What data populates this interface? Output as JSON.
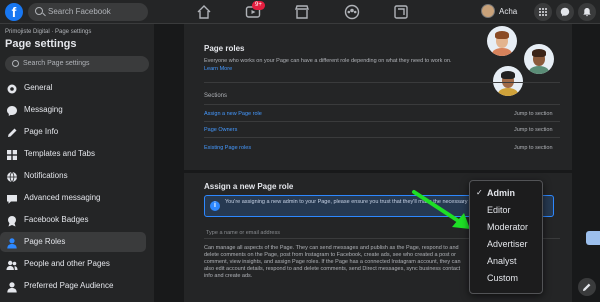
{
  "topnav": {
    "search_placeholder": "Search Facebook",
    "badge": "9+",
    "profile_name": "Acha"
  },
  "sidebar": {
    "breadcrumb": "Primojiste Digital · Page settings",
    "title": "Page settings",
    "search_placeholder": "Search Page settings",
    "items": [
      {
        "label": "General",
        "icon": "gear-icon"
      },
      {
        "label": "Messaging",
        "icon": "messaging-icon"
      },
      {
        "label": "Page Info",
        "icon": "pencil-icon"
      },
      {
        "label": "Templates and Tabs",
        "icon": "grid-icon"
      },
      {
        "label": "Notifications",
        "icon": "globe-icon"
      },
      {
        "label": "Advanced messaging",
        "icon": "chat-icon"
      },
      {
        "label": "Facebook Badges",
        "icon": "badge-icon"
      },
      {
        "label": "Page Roles",
        "icon": "user-icon",
        "active": true
      },
      {
        "label": "People and other Pages",
        "icon": "people-icon"
      },
      {
        "label": "Preferred Page Audience",
        "icon": "audience-icon"
      }
    ]
  },
  "main": {
    "page_roles": {
      "title": "Page roles",
      "desc": "Everyone who works on your Page can have a different role depending on what they need to work on.",
      "learn_more": "Learn More",
      "sections_title": "Sections",
      "sections": [
        {
          "label": "Assign a new Page role",
          "jump": "Jump to section"
        },
        {
          "label": "Page Owners",
          "jump": "Jump to section"
        },
        {
          "label": "Existing Page roles",
          "jump": "Jump to section"
        }
      ]
    },
    "assign": {
      "title": "Assign a new Page role",
      "info": "You're assigning a new admin to your Page, please ensure you trust that they'll make the necessary decisions for your Page.",
      "input_placeholder": "Type a name or email address",
      "footer": "Can manage all aspects of the Page. They can send messages and publish as the Page, respond to and delete comments on the Page, post from Instagram to Facebook, create ads, see who created a post or comment, view insights, and assign Page roles. If the Page has a connected Instagram account, they can also edit account details, respond to and delete comments, send Direct messages, sync business contact info and create ads."
    },
    "dropdown": {
      "options": [
        "Admin",
        "Editor",
        "Moderator",
        "Advertiser",
        "Analyst",
        "Custom"
      ],
      "selected": "Admin",
      "check": "✓"
    }
  },
  "colors": {
    "accent": "#2d88ff",
    "arrow": "#1ee026",
    "background": "#18191a",
    "surface": "#242526"
  }
}
